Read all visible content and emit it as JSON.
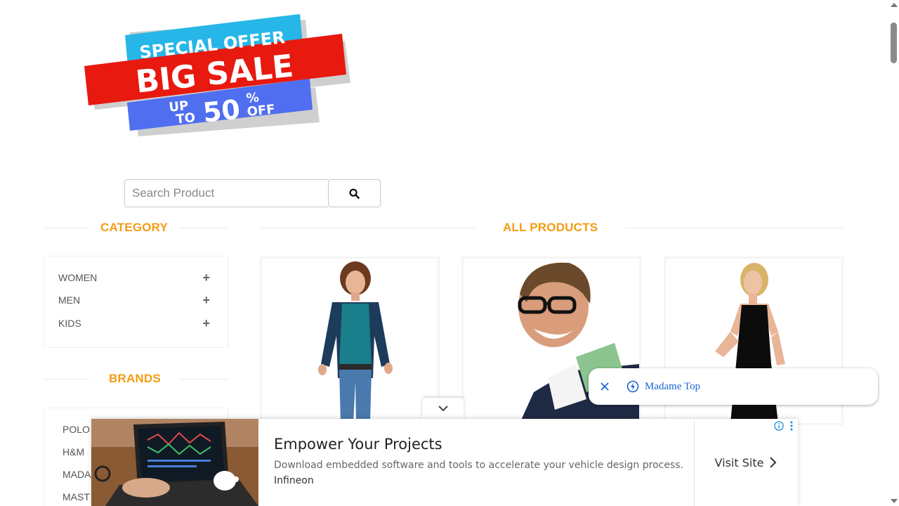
{
  "banner": {
    "line1": "SPECIAL OFFER",
    "line2": "BIG SALE",
    "line3a": "UP",
    "line3b": "TO",
    "line3c": "50",
    "line3d": "%",
    "line3e": "OFF",
    "colors": {
      "cyan": "#26b6e8",
      "red": "#e8190f",
      "blue": "#4f6ef0"
    }
  },
  "search": {
    "placeholder": "Search Product",
    "value": "",
    "icon": "search-icon"
  },
  "sidebar": {
    "category_title": "CATEGORY",
    "categories": [
      {
        "label": "WOMEN",
        "icon": "plus-icon"
      },
      {
        "label": "MEN",
        "icon": "plus-icon"
      },
      {
        "label": "KIDS",
        "icon": "plus-icon"
      }
    ],
    "brands_title": "BRANDS",
    "brands": [
      {
        "label": "POLO"
      },
      {
        "label": "H&M"
      },
      {
        "label": "MADA"
      },
      {
        "label": "MAST"
      }
    ]
  },
  "main": {
    "title": "ALL PRODUCTS",
    "products": [
      {
        "image": "woman-in-teal-top-and-cardigan"
      },
      {
        "image": "smiling-man-with-glasses"
      },
      {
        "image": "woman-in-black-dress"
      }
    ]
  },
  "toast": {
    "close_icon": "close-icon",
    "bolt_icon": "bolt-icon",
    "label": "Madame Top"
  },
  "ad": {
    "title": "Empower Your Projects",
    "description": "Download embedded software and tools to accelerate your vehicle design process.",
    "advertiser": "Infineon",
    "cta": "Visit Site",
    "collapse_icon": "chevron-down-icon",
    "info_icon": "info-icon",
    "menu_icon": "more-vertical-icon"
  },
  "theme": {
    "accent": "#f39c12",
    "link": "#1a66d4"
  }
}
